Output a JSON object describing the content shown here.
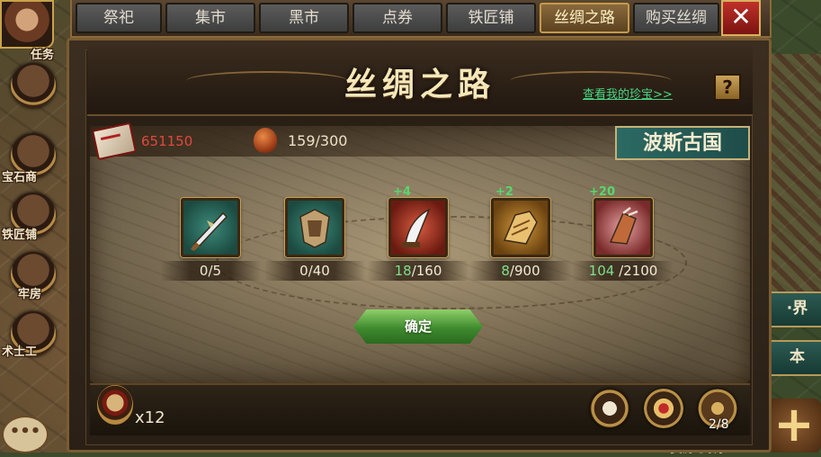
{
  "left_menu": {
    "items": [
      {
        "label": "宝石商"
      },
      {
        "label": "铁匠铺"
      },
      {
        "label": "牢房"
      },
      {
        "label": "术士工"
      }
    ],
    "task_label": "任务",
    "chat_label": "•••"
  },
  "right_menu": {
    "items": [
      {
        "label": "·界"
      },
      {
        "label": "本"
      }
    ],
    "plus_label": "+",
    "bottom_text": "资源 武将"
  },
  "tabs": [
    {
      "label": "祭祀"
    },
    {
      "label": "集市"
    },
    {
      "label": "黑市"
    },
    {
      "label": "点券"
    },
    {
      "label": "铁匠铺"
    },
    {
      "label": "丝绸之路",
      "active": true
    },
    {
      "label": "购买丝绸"
    }
  ],
  "close_label": "✕",
  "panel": {
    "title": "丝绸之路",
    "treasure_link": "查看我的珍宝>>",
    "help_label": "?"
  },
  "resources": {
    "gold": "651150",
    "bag": "159/300"
  },
  "country": "波斯古国",
  "items": [
    {
      "icon": "green-dagger-icon",
      "owned": "0",
      "required": "5",
      "bonus": ""
    },
    {
      "icon": "green-armor-icon",
      "owned": "0",
      "required": "40",
      "bonus": ""
    },
    {
      "icon": "red-blade-icon",
      "owned": "18",
      "required": "160",
      "bonus": "+4"
    },
    {
      "icon": "gold-gauntlet-icon",
      "owned": "8",
      "required": "900",
      "bonus": "+2"
    },
    {
      "icon": "pink-claw-icon",
      "owned": "104",
      "required": "2100",
      "bonus": "+20"
    }
  ],
  "confirm_label": "确定",
  "bottom": {
    "scroll_count": "x12",
    "page_counter": "2/8"
  },
  "colors": {
    "accent_gold": "#c9a24a",
    "owned_green": "#7fe08a",
    "gold_red": "#e0483c",
    "link_green": "#48d884",
    "tag_teal": "#2c6a64"
  }
}
